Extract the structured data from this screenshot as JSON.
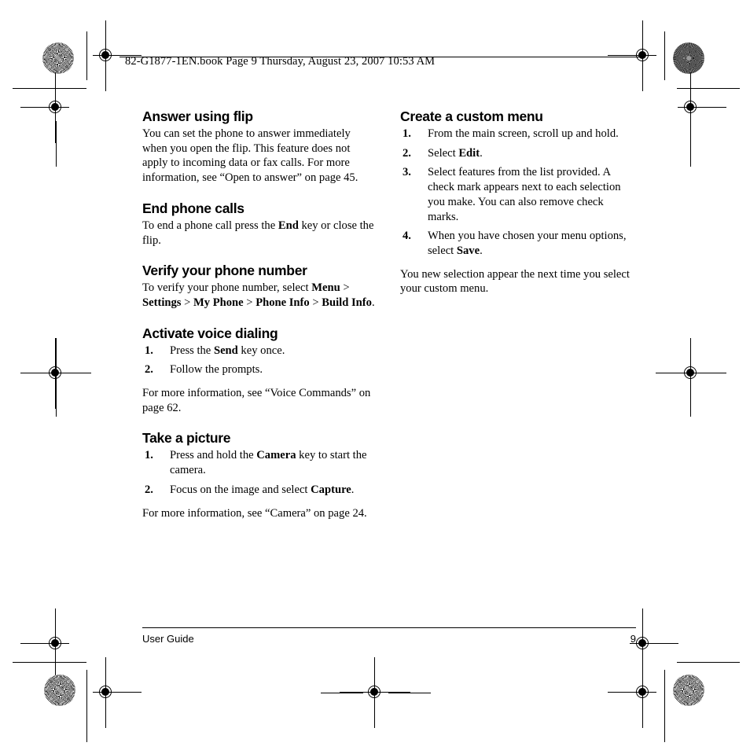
{
  "header": {
    "text": "82-G1877-1EN.book  Page 9  Thursday, August 23, 2007  10:53 AM"
  },
  "footer": {
    "left_label": "User Guide",
    "page_number": "9"
  },
  "left_column": {
    "sections": [
      {
        "heading": "Answer using flip",
        "paragraph": "You can set the phone to answer immediately when you open the flip. This feature does not apply to incoming data or fax calls. For more information, see “Open to answer” on page 45."
      },
      {
        "heading": "End phone calls",
        "paragraph_before": "To end a phone call press the ",
        "paragraph_keyword": "End",
        "paragraph_after": " key or close the flip."
      },
      {
        "heading": "Verify your phone number",
        "verify_intro": "To verify your phone number, select ",
        "verify_path": [
          "Menu",
          "Settings",
          "My Phone",
          "Phone Info",
          "Build Info"
        ],
        "verify_separator": " > ",
        "verify_end": "."
      },
      {
        "heading": "Activate voice dialing",
        "steps": [
          {
            "num": "1.",
            "before": "Press the ",
            "keyword": "Send",
            "after": " key once."
          },
          {
            "num": "2.",
            "before": "Follow the prompts.",
            "keyword": "",
            "after": ""
          }
        ],
        "closing": "For more information, see “Voice Commands” on page 62."
      },
      {
        "heading": "Take a picture",
        "steps": [
          {
            "num": "1.",
            "before": "Press and hold the ",
            "keyword": "Camera",
            "after": " key to start the camera."
          },
          {
            "num": "2.",
            "before": "Focus on the image and select ",
            "keyword": "Capture",
            "after": "."
          }
        ],
        "closing": "For more information, see “Camera” on page 24."
      }
    ]
  },
  "right_column": {
    "heading": "Create a custom menu",
    "steps": [
      {
        "num": "1.",
        "before": "From the main screen, scroll up and hold.",
        "keyword": "",
        "after": ""
      },
      {
        "num": "2.",
        "before": "Select ",
        "keyword": "Edit",
        "after": "."
      },
      {
        "num": "3.",
        "before": "Select features from the list provided. A check mark appears next to each selection you make. You can also remove check marks.",
        "keyword": "",
        "after": ""
      },
      {
        "num": "4.",
        "before": "When you have chosen your menu options, select ",
        "keyword": "Save",
        "after": "."
      }
    ],
    "closing": "You new selection appear the next time you select your custom menu."
  }
}
